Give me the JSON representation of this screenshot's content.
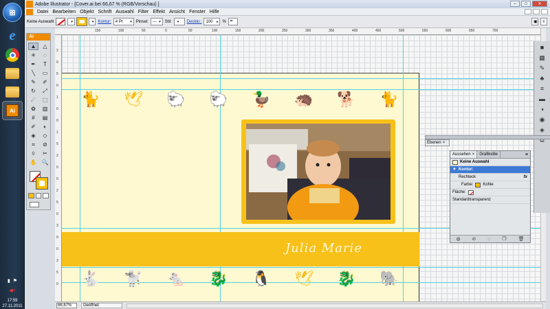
{
  "taskbar": {
    "clock_time": "17:59",
    "clock_date": "27.11.2011",
    "start_label": "⊞"
  },
  "window": {
    "title": "Adobe Illustrator - [Cover.ai bei 66,67 % (RGB/Vorschau) ]",
    "app_badge": "Ai"
  },
  "menu": {
    "items": [
      "Datei",
      "Bearbeiten",
      "Objekt",
      "Schrift",
      "Auswahl",
      "Filter",
      "Effekt",
      "Ansicht",
      "Fenster",
      "Hilfe"
    ]
  },
  "control_bar": {
    "selection_label": "Keine Auswahl",
    "kontur_label": "Kontur:",
    "stroke_weight": "4 Pt",
    "pinsel_label": "Pinsel:",
    "pinsel_value": "---",
    "stil_label": "Stil:",
    "deckkraft_label": "Deckkr.:",
    "opacity_value": "100",
    "opacity_unit": "%"
  },
  "toolbox": {
    "header": "Ai",
    "tools": [
      "selection-tool",
      "direct-selection-tool",
      "magic-wand-tool",
      "lasso-tool",
      "pen-tool",
      "type-tool",
      "line-tool",
      "rectangle-tool",
      "paintbrush-tool",
      "pencil-tool",
      "rotate-tool",
      "scale-tool",
      "warp-tool",
      "free-transform-tool",
      "symbol-sprayer-tool",
      "graph-tool",
      "mesh-tool",
      "gradient-tool",
      "eyedropper-tool",
      "blend-tool",
      "live-paint-tool",
      "live-paint-select-tool",
      "crop-tool",
      "slice-tool",
      "eraser-tool",
      "scissors-tool",
      "hand-tool",
      "zoom-tool"
    ],
    "tool_glyphs": [
      "▲",
      "△",
      "✳",
      "◌",
      "✒",
      "T",
      "╲",
      "▭",
      "✎",
      "✐",
      "↻",
      "⤢",
      "☄",
      "⬚",
      "✿",
      "▥",
      "#",
      "▤",
      "✐",
      "◐",
      "◈",
      "◇",
      "⌗",
      "⊘",
      "◊",
      "✂",
      "✋",
      "🔍"
    ]
  },
  "rulers": {
    "top_labels": [
      "150",
      "100",
      "50",
      "0",
      "50",
      "100",
      "150",
      "200",
      "250",
      "300",
      "350",
      "400",
      "450",
      "500",
      "550",
      "600",
      "650",
      "700"
    ],
    "left_labels": [
      "2",
      "0",
      "5",
      "0",
      "1",
      "0",
      "0",
      "1",
      "5",
      "2",
      "0",
      "0",
      "2",
      "5",
      "0",
      "3",
      "0",
      "0",
      "3",
      "5",
      "0"
    ]
  },
  "artwork": {
    "name_text": "Julia Marie",
    "top_animals": [
      "🐈",
      "🕊",
      "🐑",
      "🐑",
      "🦆",
      "🦔",
      "🐕",
      "🐈"
    ],
    "bottom_animals": [
      "🐇",
      "🐩",
      "🐁",
      "🐉",
      "🐧",
      "🕊",
      "🐉",
      "🐘"
    ],
    "animal_color": "#f3be1f",
    "band_color": "#f7c11a",
    "artboard_color": "#fff9d2"
  },
  "status": {
    "zoom": "66,67%",
    "state": "Geöffnet"
  },
  "ebenen_panel": {
    "tab_label": "Ebenen"
  },
  "appearance_panel": {
    "tab_aussehen": "Aussehen",
    "tab_grafikstile": "Grafikstile",
    "rows": {
      "selection": "Keine Auswahl",
      "kontur": "Kontur:",
      "rechteck": "Rechteck",
      "farbe_label": "Farbe:",
      "farbe_value": "Kohle",
      "flaeche": "Fläche:",
      "transparency": "Standardtransparenz"
    },
    "fx_label": "fx"
  }
}
